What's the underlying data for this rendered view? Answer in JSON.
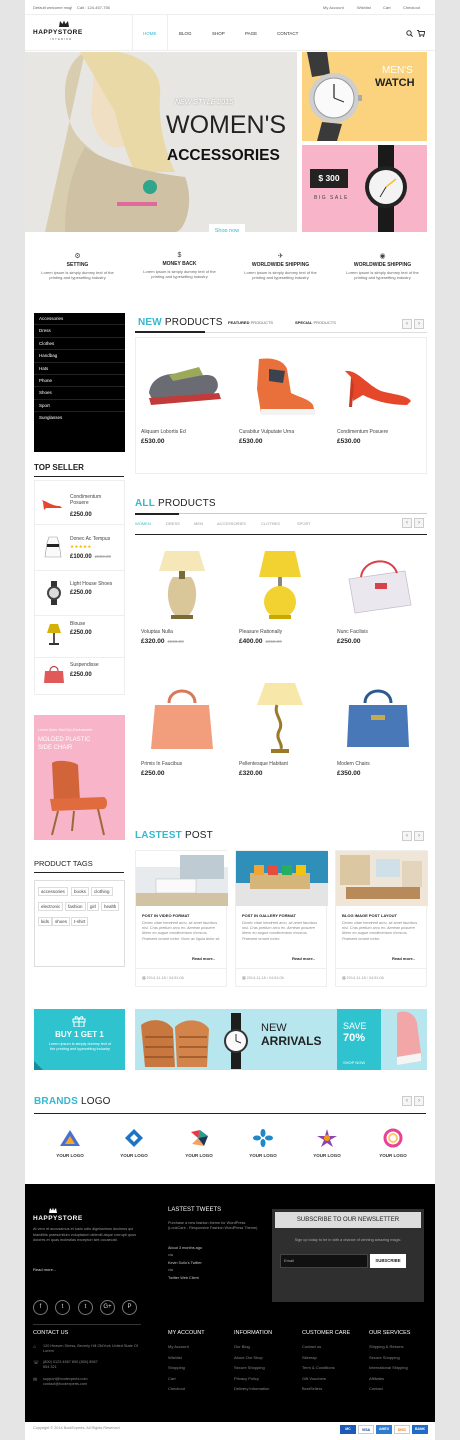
{
  "topbar": {
    "welcome": "Default welcome msg!",
    "call": "Call : 124-457-756",
    "links": [
      "My Account",
      "Wishlist",
      "Cart",
      "Checkout"
    ]
  },
  "header": {
    "logo": "HAPPYSTORE",
    "logo_sub": "INTERIOR",
    "nav": [
      "HOME",
      "BLOG",
      "SHOP",
      "PAGE",
      "CONTACT"
    ],
    "icons": [
      "search-icon",
      "cart-icon"
    ]
  },
  "hero": {
    "subtitle": "NEW STYLE 2015",
    "title1": "WOMEN'S",
    "title2": "ACCESSORIES",
    "button": "Shop now"
  },
  "banner_watch": {
    "line1": "MEN'S",
    "line2": "WATCH"
  },
  "banner_sale": {
    "price": "$ 300",
    "caption": "BIG SALE"
  },
  "features": [
    {
      "icon": "gear-icon",
      "title": "SETTING",
      "text": "Lorem ipsum is simply dummy text of the printing and typesetting industry"
    },
    {
      "icon": "dollar-icon",
      "title": "MONEY BACK",
      "text": "Lorem ipsum is simply dummy text of the printing and typesetting industry"
    },
    {
      "icon": "plane-icon",
      "title": "WORLDWIDE SHIPPING",
      "text": "Lorem ipsum is simply dummy text of the printing and typesetting industry"
    },
    {
      "icon": "globe-icon",
      "title": "WORLDWIDE SHIPPING",
      "text": "Lorem ipsum is simply dummy text of the printing and typesetting industry"
    }
  ],
  "categories": [
    "Accessories",
    "Dress",
    "Clothes",
    "Handbag",
    "Hats",
    "Phone",
    "Shoes",
    "Sport",
    "Sunglasses"
  ],
  "new_products": {
    "title_accent": "NEW",
    "title_rest": "PRODUCTS",
    "tab1_bold": "FEATURED",
    "tab1_rest": "PRODUCTS",
    "tab2_bold": "SPECIAL",
    "tab2_rest": "PRODUCTS",
    "items": [
      {
        "name": "Aliquam Lobortis Ed",
        "price": "£530.00"
      },
      {
        "name": "Curabitur Vulputate Urna",
        "price": "£530.00"
      },
      {
        "name": "Condimentum Posuere",
        "price": "£530.00"
      }
    ]
  },
  "top_seller": {
    "title": "TOP SELLER",
    "items": [
      {
        "name": "Condimentum Posuere",
        "price": "£250.00",
        "old": ""
      },
      {
        "name": "Donec Ac Tempus",
        "price": "£100.00",
        "old": "£550.00"
      },
      {
        "name": "Light House Shoes",
        "price": "£250.00",
        "old": ""
      },
      {
        "name": "Blouse",
        "price": "£250.00",
        "old": ""
      },
      {
        "name": "Suspendisse",
        "price": "£250.00",
        "old": ""
      }
    ]
  },
  "all_products": {
    "title_accent": "ALL",
    "title_rest": "PRODUCTS",
    "tabs": [
      "WOMEN",
      "DRESS",
      "MEN",
      "ACCESSORIES",
      "CLOTHES",
      "SPORT"
    ],
    "items": [
      {
        "name": "Voluptas Nulla",
        "price": "£320.00",
        "old": "£550.00"
      },
      {
        "name": "Pleasure Rationally",
        "price": "£400.00",
        "old": "£550.00"
      },
      {
        "name": "Nunc Facilisis",
        "price": "£250.00",
        "old": ""
      },
      {
        "name": "Primis In Faucibus",
        "price": "£250.00",
        "old": ""
      },
      {
        "name": "Pellentesque Habitant",
        "price": "£320.00",
        "old": ""
      },
      {
        "name": "Modern Chairs",
        "price": "£350.00",
        "old": ""
      }
    ]
  },
  "side_banner": {
    "caption": "Lorem Dolor Sed Diry Environment",
    "line1": "MOLDED PLASTIC",
    "line2": "SIDE CHAIR"
  },
  "product_tags": {
    "title": "PRODUCT TAGS",
    "tags": [
      "accessories",
      "books",
      "clothing",
      "electronic",
      "fashion",
      "girl",
      "health",
      "kids",
      "shoes",
      "t-shirt"
    ]
  },
  "latest_post": {
    "title_accent": "LASTEST",
    "title_rest": "POST",
    "posts": [
      {
        "format": "POST IN VIDEO FORMAT",
        "text": "Donec vitae hendrerit arcu, sit amet faucibus nisl. Cras pretium arcu ex. Aenean posuere libero eu augue condimentum rhoncus. Praesent ornare tortor. Nunc ac ligula dolor sit.",
        "more": "Read more..",
        "date": "2014-11-18 / 04:51:06"
      },
      {
        "format": "POST IN GALLERY FORMAT",
        "text": "Donec vitae hendrerit arcu, sit amet faucibus nisl. Cras pretium arcu ex. Aenean posuere libero eu augue condimentum rhoncus. Praesent ornare tortor.",
        "more": "Read more..",
        "date": "2014-11-18 / 04:51:06"
      },
      {
        "format": "BLOG IMAGE POST LAYOUT",
        "text": "Donec vitae hendrerit arcu, sit amet faucibus nisl. Cras pretium arcu ex. Aenean posuere libero eu augue condimentum rhoncus. Praesent ornare tortor.",
        "more": "Read more..",
        "date": "2014-11-18 / 04:51:06"
      }
    ]
  },
  "promo_buy": {
    "title": "BUY 1 GET 1",
    "text": "Lorem ipsum is simply dummy text of the printing and typesetting industry"
  },
  "promo_arrivals": {
    "line1": "NEW",
    "line2": "ARRIVALS",
    "save": "SAVE",
    "percent": "70%",
    "shop": "SHOP NOW"
  },
  "brands": {
    "title_accent": "BRANDS",
    "title_rest": "LOGO",
    "label": "YOUR LOGO"
  },
  "footer": {
    "logo": "HAPPYSTORE",
    "about": "At vero et accusamus et iusto odio dignissimos ducimus qui blanditiis praesentium voluptatum deleniti atque corrupti quos dolores et quas molestias excepturi sint occaecati.",
    "read_more": "Read more...",
    "tweets_title": "LASTEST TWEETS",
    "tweet_text": "Purchase a new fashion theme for WordPress (LookCare - Responsive Fashion WordPress Theme)",
    "tweet_time": "About 3 months ago",
    "tweet_from": "via",
    "tweet_user": "Kevin Sollo's Twitter",
    "tweet_link": "Twitter Web Client",
    "newsletter_title": "SUBSCRIBE TO OUR NEWSLETTER",
    "newsletter_text": "Sign up today to be in with a chance of winning amazing magic.",
    "email_placeholder": "Email",
    "subscribe": "SUBSCRIBE",
    "social": [
      "f",
      "t",
      "t",
      "G+",
      "P"
    ],
    "contact_title": "CONTACT US",
    "address": "120 Heaven Stress, Beverly Hill OldYork United State Of Lorem",
    "phone": "(800) 0123 4567 890 (800) 8967 654 321",
    "email": "support@bootexperts.com contact@bootexperts.com",
    "columns": [
      {
        "title": "MY ACCOUNT",
        "links": [
          "My Account",
          "Wishlist",
          "Shopping",
          "Cart",
          "Checkout"
        ]
      },
      {
        "title": "INFORMATION",
        "links": [
          "Our Blog",
          "About Our Shop",
          "Secure Shopping",
          "Privacy Policy",
          "Delivery information"
        ]
      },
      {
        "title": "CUSTOMER CARE",
        "links": [
          "Contact us",
          "Sitemap",
          "Term & Conditions",
          "Gift Vouchers",
          "BestSellers"
        ]
      },
      {
        "title": "OUR SERVICES",
        "links": [
          "Shipping & Returns",
          "Secure Shopping",
          "International Shipping",
          "Affiliates",
          "Contact"
        ]
      }
    ],
    "copyright": "Copyright © 2014 BootExperts. All Rights Reserved",
    "payments": [
      "MC",
      "VISA",
      "AMEX",
      "DISC",
      "BANK"
    ]
  },
  "colors": {
    "accent": "#35b8d0",
    "banner_yellow": "#fbd27d",
    "banner_pink": "#f8b4c8",
    "promo_cyan": "#2ec3cf",
    "promo_light": "#b8e6ef"
  }
}
